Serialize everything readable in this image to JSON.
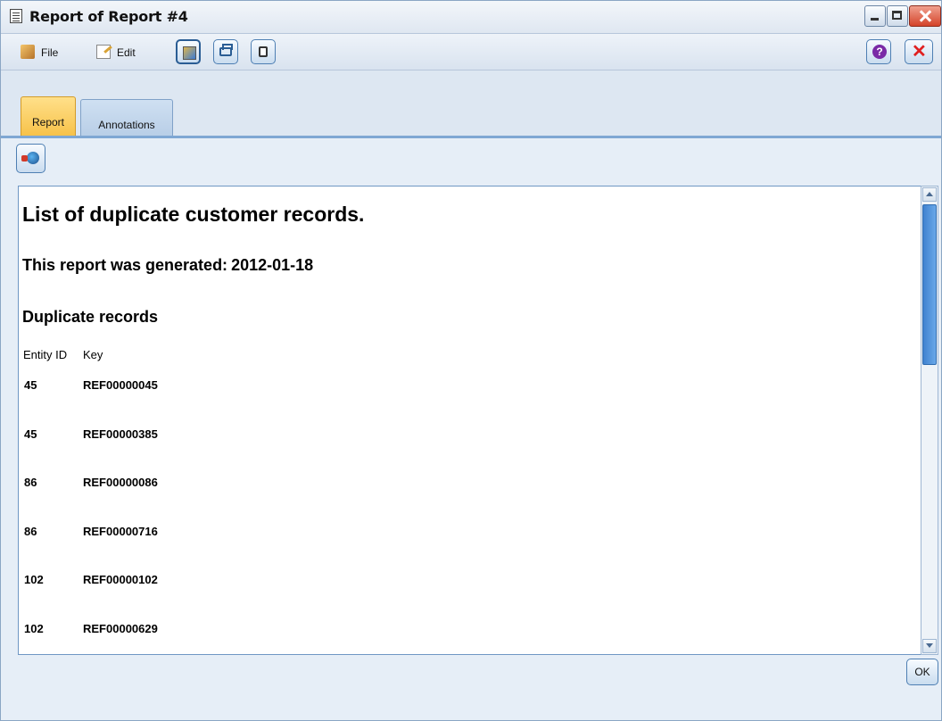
{
  "window": {
    "title": "Report of Report #4"
  },
  "toolbar": {
    "file_label": "File",
    "edit_label": "Edit"
  },
  "tabs": [
    {
      "label": "Report",
      "active": true
    },
    {
      "label": "Annotations",
      "active": false
    }
  ],
  "report": {
    "title": "List of duplicate customer records.",
    "generated_prefix": "This report was generated:",
    "generated_date": "2012-01-18",
    "section_heading": "Duplicate records",
    "columns": [
      "Entity ID",
      "Key"
    ],
    "rows": [
      {
        "entity_id": "45",
        "key": "REF00000045"
      },
      {
        "entity_id": "45",
        "key": "REF00000385"
      },
      {
        "entity_id": "86",
        "key": "REF00000086"
      },
      {
        "entity_id": "86",
        "key": "REF00000716"
      },
      {
        "entity_id": "102",
        "key": "REF00000102"
      },
      {
        "entity_id": "102",
        "key": "REF00000629"
      }
    ]
  },
  "footer": {
    "ok_label": "OK"
  },
  "icons": {
    "title": "report-window-icon",
    "file": "folder-icon",
    "edit": "edit-document-icon",
    "generate": "generate-node-icon",
    "print": "print-icon",
    "refresh": "refresh-icon",
    "help": "help-icon",
    "close": "close-red-x-icon",
    "browser": "globe-browser-icon"
  },
  "colors": {
    "active_tab": "#f7c24a",
    "accent_blue": "#3f82d0",
    "close_red": "#d4432a"
  }
}
